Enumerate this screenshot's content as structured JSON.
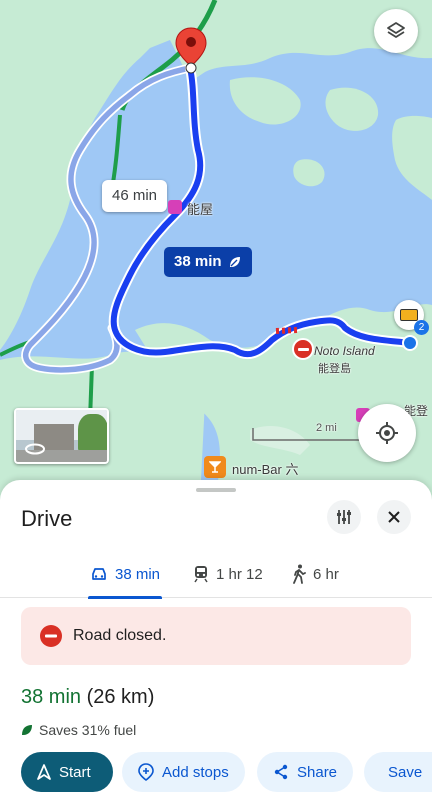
{
  "map": {
    "alt_route_time": "46 min",
    "main_route_time": "38 min",
    "label_noya": "能屋",
    "label_noto_island": "Noto Island",
    "label_noto_jp": "能登島",
    "label_noto_right": "能登",
    "label_scale": "2 mi",
    "label_bar": "num-Bar 六",
    "vehicle_badge": "2",
    "layers_icon": "layers-icon",
    "locate_icon": "my-location-icon"
  },
  "sheet": {
    "title": "Drive",
    "tabs": [
      {
        "label": "38 min",
        "icon": "car-icon",
        "active": true
      },
      {
        "label": "1 hr 12",
        "icon": "train-icon",
        "active": false
      },
      {
        "label": "6 hr",
        "icon": "walk-icon",
        "active": false
      }
    ],
    "alert": "Road closed.",
    "duration": "38 min",
    "distance": "(26 km)",
    "fuel_note": "Saves 31% fuel",
    "actions": {
      "start": "Start",
      "add_stops": "Add stops",
      "share": "Share",
      "save": "Save"
    }
  },
  "colors": {
    "route": "#1a3ff0",
    "route_alt": "#8aa6e8",
    "water": "#9fc8f5",
    "land": "#c6ebd4",
    "start_button": "#0d5c77",
    "duration_green": "#137333"
  }
}
